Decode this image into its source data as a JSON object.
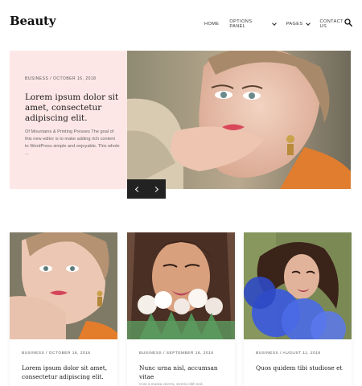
{
  "site": {
    "logo": "Beauty"
  },
  "nav": {
    "items": [
      {
        "label": "HOME",
        "active": true,
        "has_dropdown": false
      },
      {
        "label": "OPTIONS PANEL",
        "active": false,
        "has_dropdown": true
      },
      {
        "label": "PAGES",
        "active": false,
        "has_dropdown": true
      },
      {
        "label": "CONTACT US",
        "active": false,
        "has_dropdown": false
      }
    ],
    "search_icon": "search-icon",
    "active_highlight_color": "#f6c7c4"
  },
  "hero": {
    "category": "BUSINESS",
    "separator": "/",
    "date": "OCTOBER 16, 2018",
    "title": "Lorem ipsum dolor sit amet, consectetur adipiscing elit.",
    "excerpt": "Of Mountains & Printing Presses The goal of this new editor is to make adding rich content to WordPress simple and enjoyable. This whole ...",
    "card_background": "#fde7e6",
    "controls": {
      "prev_icon": "chevron-left-icon",
      "next_icon": "chevron-right-icon"
    }
  },
  "posts": [
    {
      "category": "BUSINESS",
      "separator": "/",
      "date": "OCTOBER 16, 2018",
      "title": "Lorem ipsum dolor sit amet, consectetur adipiscing elit.",
      "excerpt": ""
    },
    {
      "category": "BUSINESS",
      "separator": "/",
      "date": "SEPTEMBER 18, 2018",
      "title": "Nunc urna nisl, accumsan vitae",
      "excerpt": "Cras a massa viverra, viverra nibh sed,"
    },
    {
      "category": "BUSINESS",
      "separator": "/",
      "date": "AUGUST 11, 2018",
      "title": "Quos quidem tibi studiose et",
      "excerpt": ""
    }
  ]
}
